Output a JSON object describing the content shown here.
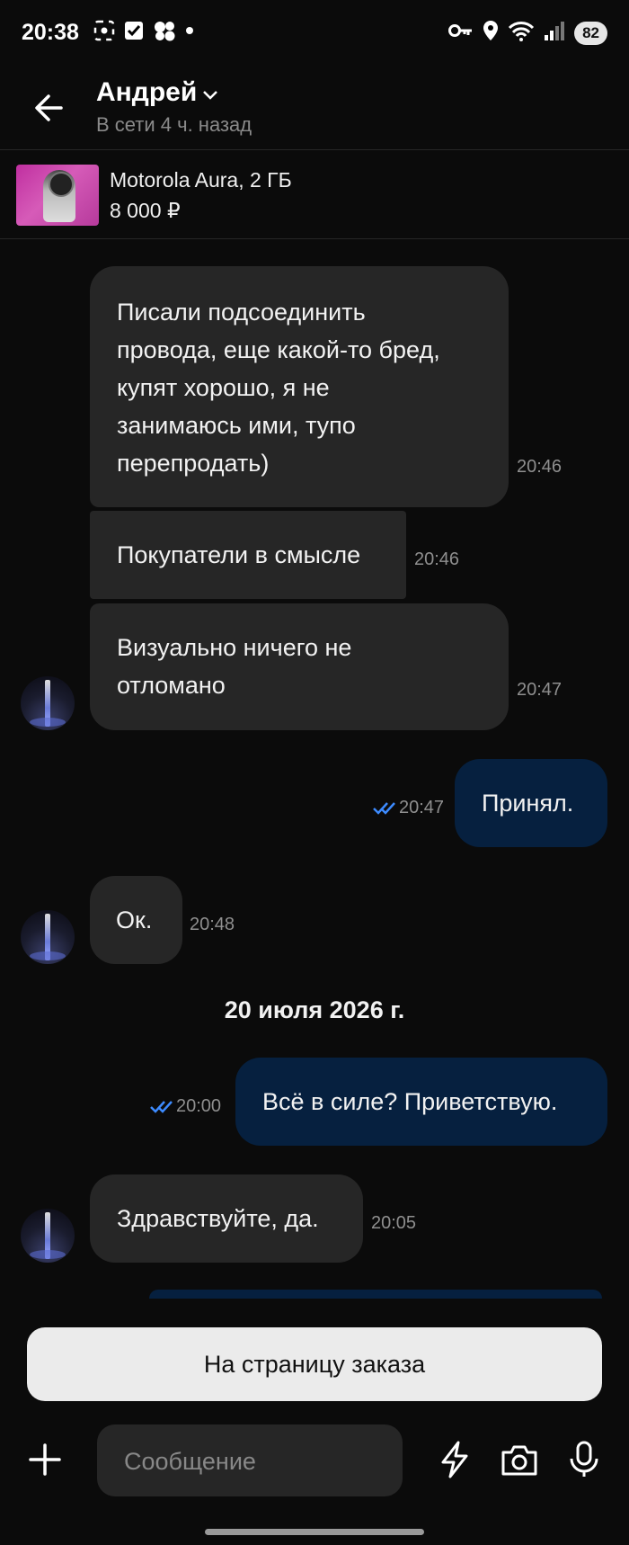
{
  "status": {
    "time": "20:38",
    "battery": "82"
  },
  "header": {
    "name": "Андрей",
    "presence": "В сети 4 ч. назад"
  },
  "product": {
    "title": "Motorola Aura, 2 ГБ",
    "price": "8 000 ₽"
  },
  "messages": [
    {
      "lines": [
        "Писали подсоединить",
        "провода, еще какой-то бред,",
        "купят хорошо, я не",
        "занимаюсь ими, тупо",
        "перепродать)"
      ],
      "time": "20:46"
    },
    {
      "lines": [
        "Покупатели в смысле"
      ],
      "time": "20:46"
    },
    {
      "lines": [
        "Визуально ничего не",
        "отломано"
      ],
      "time": "20:47"
    },
    {
      "lines": [
        "Принял."
      ],
      "time": "20:47"
    },
    {
      "lines": [
        "Ок."
      ],
      "time": "20:48"
    },
    {
      "lines": [
        "Всё в силе? Приветствую."
      ],
      "time": "20:00"
    },
    {
      "lines": [
        "Здравствуйте, да."
      ],
      "time": "20:05"
    }
  ],
  "date_separator": "20 июля 2026 г.",
  "order_button": "На страницу заказа",
  "composer": {
    "placeholder": "Сообщение"
  },
  "colors": {
    "background": "#0b0b0b",
    "incoming": "#262626",
    "outgoing": "#06203f",
    "read_checks": "#3d8bff"
  }
}
